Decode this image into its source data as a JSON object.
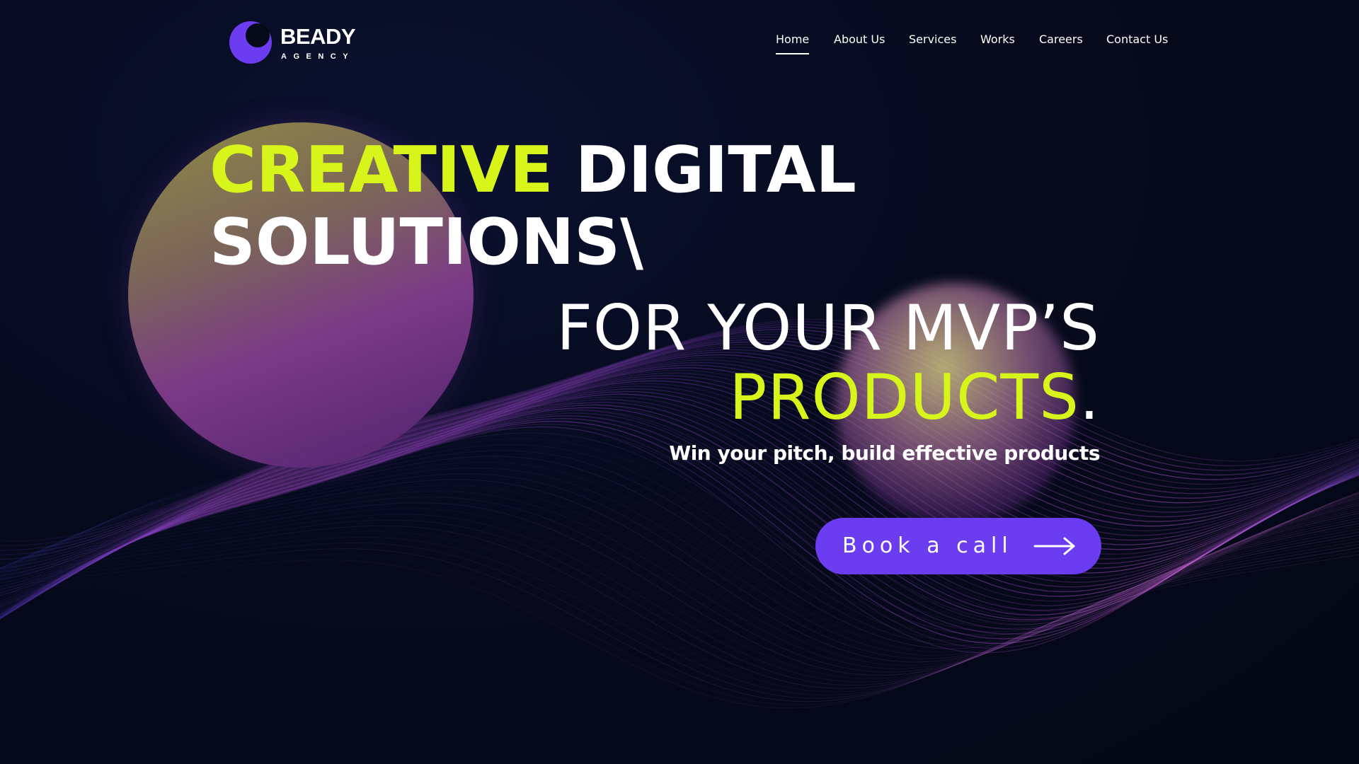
{
  "brand": {
    "name": "BEADY",
    "subtitle": "AGENCY",
    "accent_color": "#6c3cf0",
    "highlight_color": "#d7f51a"
  },
  "nav": {
    "items": [
      {
        "label": "Home",
        "active": true
      },
      {
        "label": "About Us",
        "active": false
      },
      {
        "label": "Services",
        "active": false
      },
      {
        "label": "Works",
        "active": false
      },
      {
        "label": "Careers",
        "active": false
      },
      {
        "label": "Contact Us",
        "active": false
      }
    ]
  },
  "hero": {
    "line1_highlight": "CREATIVE",
    "line1_rest": "DIGITAL",
    "line2": "SOLUTIONS\\",
    "line3": "FOR YOUR MVP’S",
    "line4_highlight": "PRODUCTS",
    "line4_end": ".",
    "tagline": "Win your pitch, build effective products",
    "cta_label": "Book a call",
    "cta_icon": "arrow-right-icon"
  }
}
